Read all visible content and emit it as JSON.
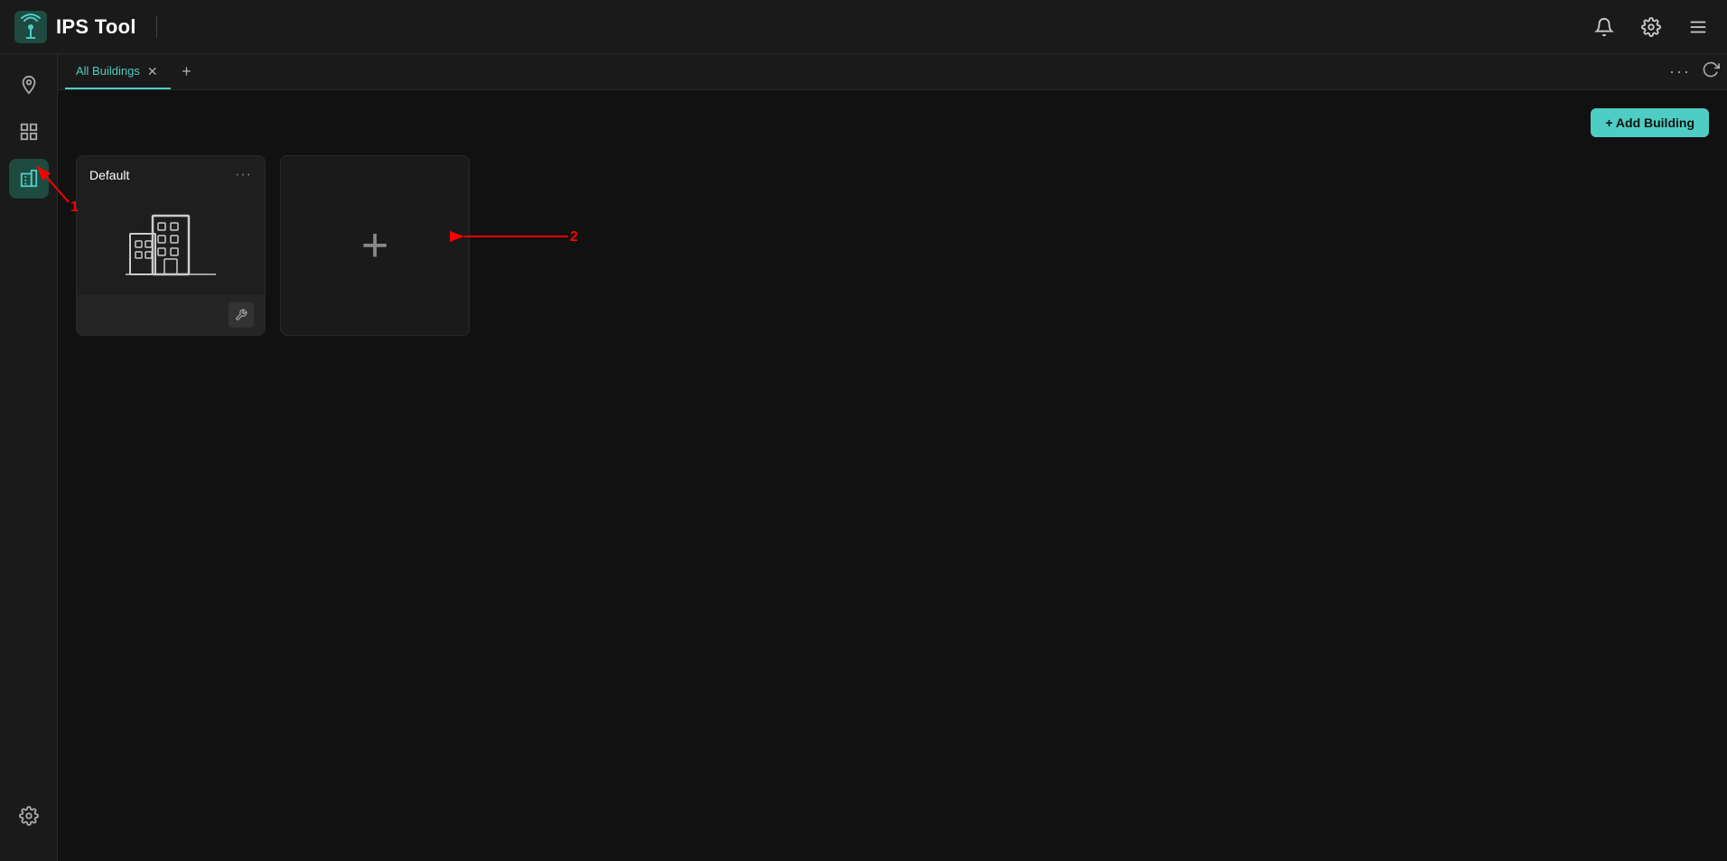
{
  "app": {
    "title": "IPS Tool",
    "logo_alt": "IPS antenna icon"
  },
  "header": {
    "title": "IPS Tool",
    "divider": "|",
    "icons": {
      "bell": "🔔",
      "settings": "⚙",
      "menu": "☰"
    }
  },
  "sidebar": {
    "items": [
      {
        "id": "map",
        "label": "Map",
        "active": false
      },
      {
        "id": "dashboard",
        "label": "Dashboard",
        "active": false
      },
      {
        "id": "buildings",
        "label": "Buildings",
        "active": true
      }
    ],
    "bottom": [
      {
        "id": "settings",
        "label": "Settings",
        "active": false
      }
    ]
  },
  "tabs": [
    {
      "id": "all-buildings",
      "label": "All Buildings",
      "active": true,
      "closable": true
    }
  ],
  "tab_add_label": "+",
  "tab_bar_right": {
    "more_options": "···",
    "refresh": "↺"
  },
  "content": {
    "add_building_button": "+ Add Building",
    "buildings": [
      {
        "id": "default",
        "title": "Default",
        "more_menu": "···"
      }
    ],
    "add_card_symbol": "+"
  },
  "annotations": {
    "arrow1_number": "1",
    "arrow2_number": "2"
  },
  "colors": {
    "accent": "#4ecdc4",
    "bg_dark": "#111111",
    "bg_card": "#1e1e1e",
    "bg_header": "#1a1a1a",
    "sidebar_active": "#1e4a40",
    "red": "#ff0000"
  }
}
